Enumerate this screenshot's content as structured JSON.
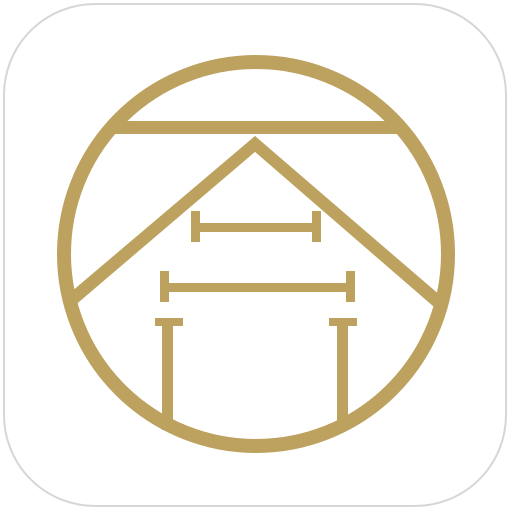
{
  "app_icon": {
    "name": "gold-gate-emblem-icon",
    "colors": {
      "gold": "#bca15f",
      "tile_background": "#ffffff",
      "tile_border": "#d6d6d6"
    }
  }
}
